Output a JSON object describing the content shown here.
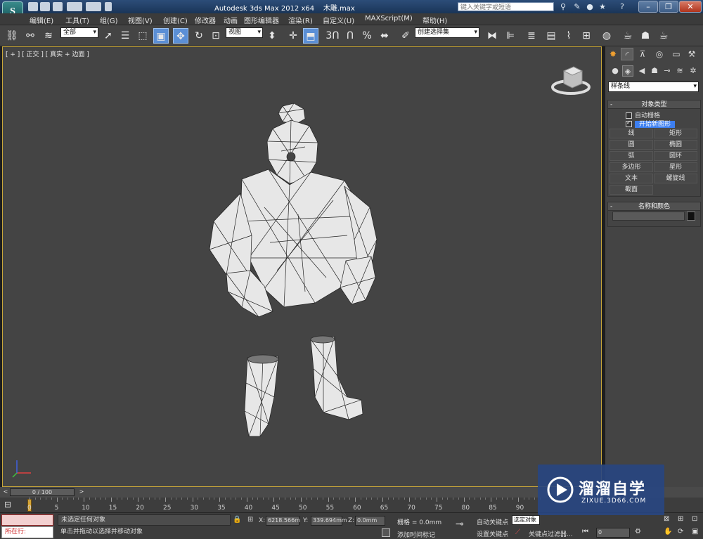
{
  "window": {
    "title": "Autodesk 3ds Max  2012 x64",
    "filename": "木雕.max",
    "help_search_placeholder": "键入关键字或短语"
  },
  "menu": [
    "编辑(E)",
    "工具(T)",
    "组(G)",
    "视图(V)",
    "创建(C)",
    "修改器",
    "动画",
    "图形编辑器",
    "渲染(R)",
    "自定义(U)",
    "MAXScript(M)",
    "帮助(H)"
  ],
  "toolbar": {
    "selection_filter": "全部",
    "reference_coord": "视图",
    "named_selection": "创建选择集"
  },
  "viewport": {
    "label": "[ + ] [ 正交 ] [ 真实 + 边面 ]"
  },
  "command_panel": {
    "category_dropdown": "样条线",
    "object_type": {
      "title": "对象类型",
      "auto_grid": "自动栅格",
      "start_new_shape": "开始新图形",
      "buttons": [
        "线",
        "矩形",
        "圆",
        "椭圆",
        "弧",
        "圆环",
        "多边形",
        "星形",
        "文本",
        "螺旋线",
        "截面"
      ]
    },
    "name_color": {
      "title": "名称和颜色"
    }
  },
  "timeline": {
    "slider_label": "0 / 100",
    "ticks": [
      "0",
      "5",
      "10",
      "15",
      "20",
      "25",
      "30",
      "35",
      "40",
      "45",
      "50",
      "55",
      "60",
      "65",
      "70",
      "75",
      "80",
      "85",
      "90"
    ]
  },
  "status": {
    "maxscript_label": "所在行:",
    "selection_status": "未选定任何对象",
    "prompt": "单击并拖动以选择并移动对象",
    "x_label": "X:",
    "x_value": "6218.566m",
    "y_label": "Y:",
    "y_value": "339.694mm",
    "z_label": "Z:",
    "z_value": "0.0mm",
    "grid": "栅格 = 0.0mm",
    "add_time_tag": "添加时间标记",
    "auto_key": "自动关键点",
    "set_key": "设置关键点",
    "selected_dropdown": "选定对象",
    "key_filters": "关键点过滤器...",
    "frame": "0"
  },
  "watermark": {
    "title": "溜溜自学",
    "url": "ZIXUE.3D66.COM"
  }
}
